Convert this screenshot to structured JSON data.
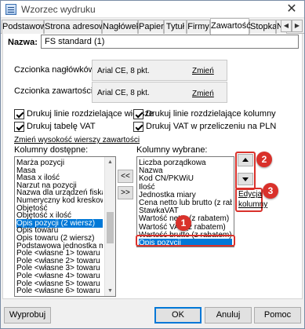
{
  "window": {
    "title": "Wzorzec wydruku",
    "close": "✕"
  },
  "tabs": [
    {
      "label": "Podstawowe"
    },
    {
      "label": "Strona adresowa"
    },
    {
      "label": "Nagłówek"
    },
    {
      "label": "Papier"
    },
    {
      "label": "Tytuł"
    },
    {
      "label": "Firmy"
    },
    {
      "label": "Zawartość"
    },
    {
      "label": "Stopka"
    },
    {
      "label": "Nal"
    }
  ],
  "tab_scroll": {
    "left": "◀",
    "right": "▶"
  },
  "name": {
    "label": "Nazwa:",
    "value": "FS standard (1)"
  },
  "fonts": {
    "header_label": "Czcionka nagłówków:",
    "header_value": "Arial CE, 8 pkt.",
    "content_label": "Czcionka zawartości:",
    "content_value": "Arial CE, 8 pkt.",
    "change": "Zmień"
  },
  "checkboxes": {
    "row_lines": "Drukuj linie rozdzielające wiersze",
    "col_lines": "Drukuj linie rozdzielające kolumny",
    "vat_table": "Drukuj tabelę VAT",
    "vat_pln": "Drukuj VAT w przeliczeniu na PLN"
  },
  "row_height_link": "Zmień wysokość wierszy zawartości",
  "available": {
    "label": "Kolumny dostępne:",
    "items": [
      "Marża pozycji",
      "Masa",
      "Masa x ilość",
      "Narzut na pozycji",
      "Nazwa dla urządzeń fiskalnych",
      "Numeryczny kod kreskowy",
      "Objętość",
      "Objętość x ilość",
      "Opis pozycji (2 wiersz)",
      "Opis towaru",
      "Opis towaru (2 wiersz)",
      "Podstawowa jednostka miary",
      "Pole <własne 1> towaru",
      "Pole <własne 2> towaru",
      "Pole <własne 3> towaru",
      "Pole <własne 4> towaru",
      "Pole <własne 5> towaru",
      "Pole <własne 6> towaru"
    ],
    "selected_index": 8
  },
  "move_buttons": {
    "left": "<<",
    "right": ">>"
  },
  "selected": {
    "label": "Kolumny wybrane:",
    "items": [
      "Liczba porządkowa",
      "Nazwa",
      "Kod CN/PKWiU",
      "Ilość",
      "Jednostka miary",
      "Cena netto lub brutto (z rabatem)",
      "StawkaVAT",
      "Wartość netto (z rabatem)",
      "Wartość VAT (z rabatem)",
      "Wartość brutto (z rabatem)",
      "Opis pozycji"
    ],
    "selected_index": 10
  },
  "edit_link": {
    "line1": "Edycja",
    "line2": "kolumny"
  },
  "callouts": [
    "1",
    "2",
    "3"
  ],
  "footer": {
    "preview": "Wyprobuj",
    "ok": "OK",
    "cancel": "Anuluj",
    "help": "Pomoc"
  },
  "colors": {
    "accent": "#0078d7",
    "callout": "#d9312b"
  }
}
